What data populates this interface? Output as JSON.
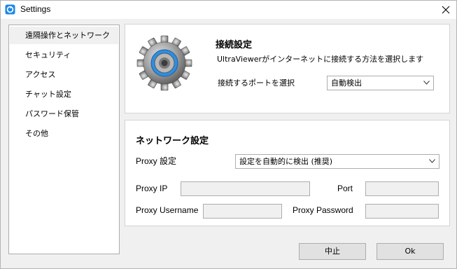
{
  "window": {
    "title": "Settings"
  },
  "sidebar": {
    "items": [
      {
        "label": "遠隔操作とネットワーク",
        "selected": true
      },
      {
        "label": "セキュリティ",
        "selected": false
      },
      {
        "label": "アクセス",
        "selected": false
      },
      {
        "label": "チャット設定",
        "selected": false
      },
      {
        "label": "パスワード保管",
        "selected": false
      },
      {
        "label": "その他",
        "selected": false
      }
    ]
  },
  "connection": {
    "title": "接続設定",
    "description": "UltraViewerがインターネットに接続する方法を選択します",
    "port_label": "接続するポートを選択",
    "port_value": "自動検出"
  },
  "network": {
    "title": "ネットワーク設定",
    "proxy_label": "Proxy 設定",
    "proxy_value": "設定を自動的に検出 (推奨)",
    "proxy_ip_label": "Proxy IP",
    "proxy_ip_value": "",
    "port_label": "Port",
    "port_value": "",
    "username_label": "Proxy Username",
    "username_value": "",
    "password_label": "Proxy Password",
    "password_value": ""
  },
  "buttons": {
    "cancel": "中止",
    "ok": "Ok"
  },
  "colors": {
    "app_icon": "#1e88e5",
    "gear_ring": "#3a9be8"
  }
}
